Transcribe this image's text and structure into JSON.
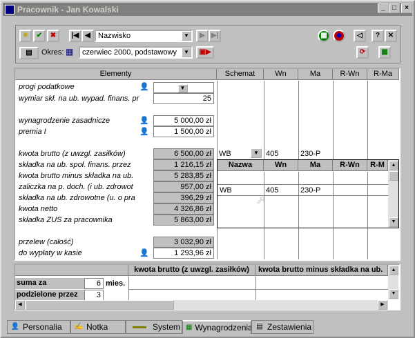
{
  "window": {
    "title": "Pracownik - Jan Kowalski"
  },
  "toolbar": {
    "sort_field": "Nazwisko",
    "period_label": "Okres:",
    "period_value": "czerwiec 2000, podstawowy"
  },
  "grid": {
    "headers": {
      "elements": "Elementy",
      "schemat": "Schemat",
      "wn": "Wn",
      "ma": "Ma",
      "rwn": "R-Wn",
      "rma": "R-Ma"
    },
    "rows": [
      {
        "label": "progi podatkowe",
        "value": ""
      },
      {
        "label": "wymiar skł. na ub. wypad. finans. pr",
        "value": "25"
      },
      {
        "label": "wynagrodzenie zasadnicze",
        "value": "5 000,00 zł"
      },
      {
        "label": "premia I",
        "value": "1 500,00 zł"
      },
      {
        "label": "kwota brutto (z uwzgl. zasiłków)",
        "value": "6 500,00 zł"
      },
      {
        "label": "składka na ub. społ. finans. przez",
        "value": "1 216,15 zł"
      },
      {
        "label": "kwota brutto minus składka na ub.",
        "value": "5 283,85 zł"
      },
      {
        "label": "zaliczka na p. doch. (i ub. zdrowot",
        "value": "957,00 zł"
      },
      {
        "label": "składka na ub. zdrowotne (u. o pra",
        "value": "396,29 zł"
      },
      {
        "label": "kwota netto",
        "value": "4 326,86 zł"
      },
      {
        "label": "składka ZUS za pracownika",
        "value": "5 863,00 zł"
      },
      {
        "label": "przelew (całość)",
        "value": "3 032,90 zł"
      },
      {
        "label": "do wypłaty w kasie",
        "value": "1 293,96 zł"
      }
    ],
    "schema_row": {
      "schemat": "WB",
      "wn": "405",
      "ma": "230-P"
    }
  },
  "popup": {
    "headers": {
      "nazwa": "Nazwa",
      "wn": "Wn",
      "ma": "Ma",
      "rwn": "R-Wn",
      "rma": "R-M"
    },
    "row": {
      "nazwa": "WB",
      "wn": "405",
      "ma": "230-P"
    }
  },
  "summary": {
    "col1": "kwota brutto (z uwzgl. zasiłków)",
    "col2": "kwota brutto minus składka na ub.",
    "suma_label": "suma za",
    "suma_value": "6",
    "suma_unit": "mies.",
    "podzielone_label": "podzielone przez",
    "podzielone_value": "3"
  },
  "tabs": [
    {
      "label": "Personalia",
      "icon": "person-icon"
    },
    {
      "label": "Notka",
      "icon": "note-icon"
    },
    {
      "label": "System",
      "icon": "system-icon"
    },
    {
      "label": "Wynagrodzenia",
      "icon": "spreadsheet-icon"
    },
    {
      "label": "Zestawienia",
      "icon": "report-icon"
    }
  ]
}
